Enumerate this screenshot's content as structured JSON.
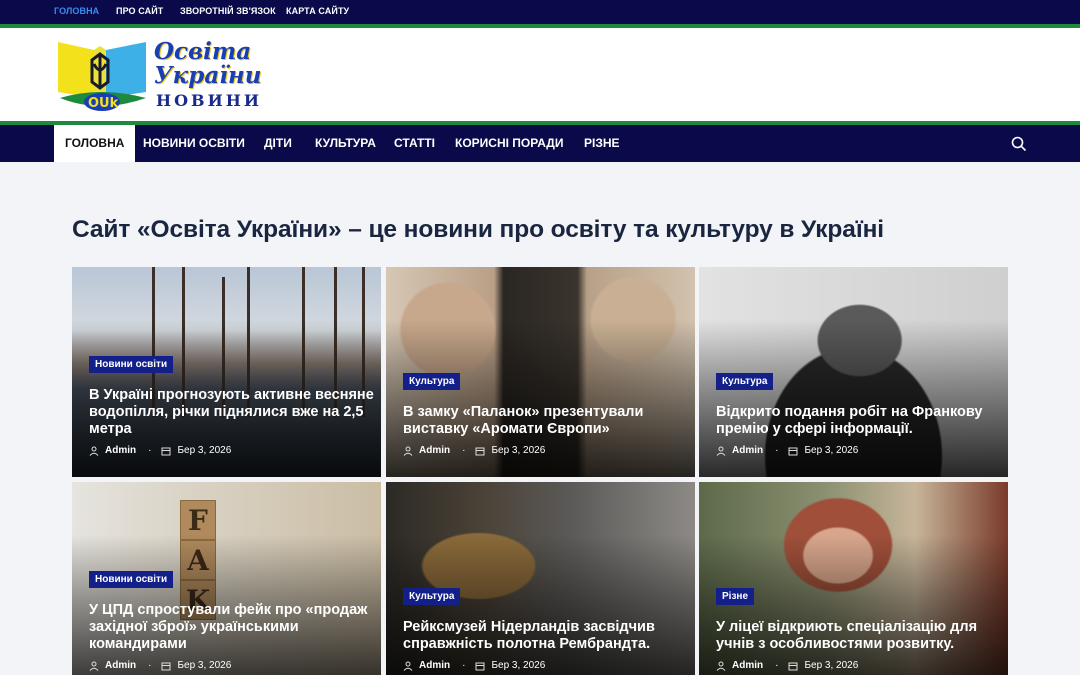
{
  "topbar": {
    "links": [
      "Головна",
      "Про сайт",
      "Зворотній зв'язок",
      "Карта сайту"
    ]
  },
  "logo": {
    "line1": "Освіта",
    "line2": "України",
    "line3": "НОВИНИ",
    "badge": "OUk"
  },
  "nav": {
    "items": [
      "Головна",
      "Новини освіти",
      "Діти",
      "Культура",
      "Статті",
      "Корисні поради",
      "Різне"
    ]
  },
  "page": {
    "title": "Сайт «Освіта України» – це новини про освіту та культуру в Україні"
  },
  "cards": [
    {
      "category": "Новини освіти",
      "title": "В Україні прогнозують активне весняне водопілля, річки піднялися вже на 2,5 метра",
      "author": "Admin",
      "date": "Бер 3, 2026"
    },
    {
      "category": "Культура",
      "title": "В замку «Паланок» презентували виставку «Аромати Європи»",
      "author": "Admin",
      "date": "Бер 3, 2026"
    },
    {
      "category": "Культура",
      "title": "Відкрито подання робіт на Франкову премію у сфері інформації.",
      "author": "Admin",
      "date": "Бер 3, 2026"
    },
    {
      "category": "Новини освіти",
      "title": "У ЦПД спростували фейк про «продаж західної зброї» українськими командирами",
      "author": "Admin",
      "date": "Бер 3, 2026"
    },
    {
      "category": "Культура",
      "title": "Рейксмузей Нідерландів засвідчив справжність полотна Рембрандта.",
      "author": "Admin",
      "date": "Бер 3, 2026"
    },
    {
      "category": "Різне",
      "title": "У ліцеї відкриють спеціалізацію для учнів з особливостями розвитку.",
      "author": "Admin",
      "date": "Бер 3, 2026"
    }
  ],
  "colors": {
    "navy": "#0a0a4a",
    "green_stripe": "#1d8a3e",
    "badge": "#14208a",
    "active_top_link": "#3a8cf0"
  }
}
